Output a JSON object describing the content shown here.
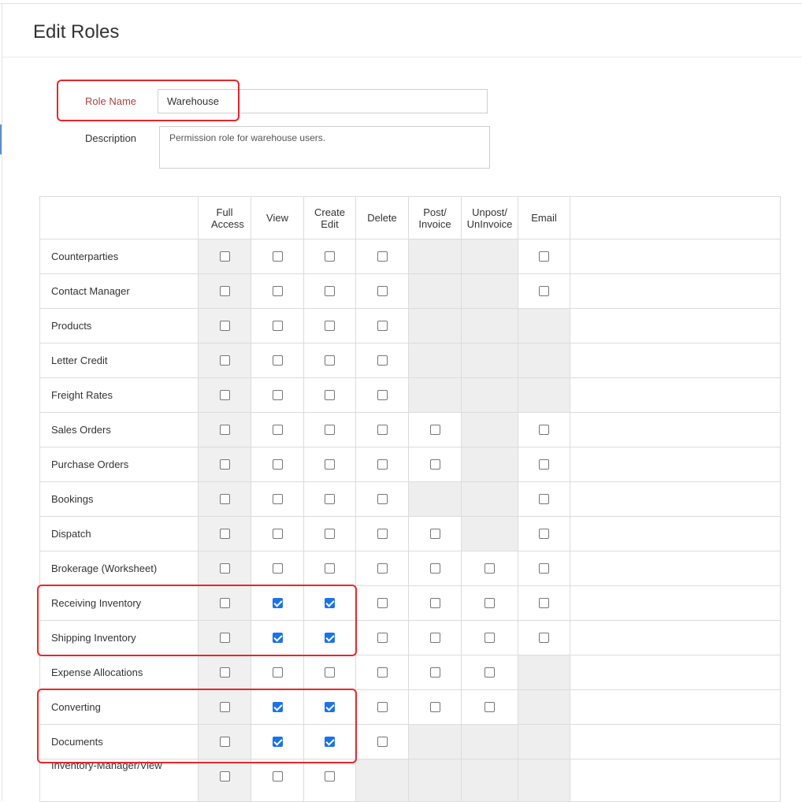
{
  "page": {
    "title": "Edit Roles"
  },
  "form": {
    "role_name_label": "Role Name",
    "role_name_value": "Warehouse",
    "description_label": "Description",
    "description_value": "Permission role for warehouse users."
  },
  "table": {
    "columns": [
      {
        "key": "full",
        "label": "Full Access"
      },
      {
        "key": "view",
        "label": "View"
      },
      {
        "key": "create",
        "label": "Create Edit"
      },
      {
        "key": "delete",
        "label": "Delete"
      },
      {
        "key": "post",
        "label": "Post/ Invoice"
      },
      {
        "key": "unpost",
        "label": "Unpost/ UnInvoice"
      },
      {
        "key": "email",
        "label": "Email"
      }
    ],
    "rows": [
      {
        "label": "Counterparties",
        "cells": {
          "full": false,
          "view": false,
          "create": false,
          "delete": false,
          "post": null,
          "unpost": null,
          "email": false
        }
      },
      {
        "label": "Contact Manager",
        "cells": {
          "full": false,
          "view": false,
          "create": false,
          "delete": false,
          "post": null,
          "unpost": null,
          "email": false
        }
      },
      {
        "label": "Products",
        "cells": {
          "full": false,
          "view": false,
          "create": false,
          "delete": false,
          "post": null,
          "unpost": null,
          "email": null
        }
      },
      {
        "label": "Letter Credit",
        "cells": {
          "full": false,
          "view": false,
          "create": false,
          "delete": false,
          "post": null,
          "unpost": null,
          "email": null
        }
      },
      {
        "label": "Freight Rates",
        "cells": {
          "full": false,
          "view": false,
          "create": false,
          "delete": false,
          "post": null,
          "unpost": null,
          "email": null
        }
      },
      {
        "label": "Sales Orders",
        "cells": {
          "full": false,
          "view": false,
          "create": false,
          "delete": false,
          "post": false,
          "unpost": null,
          "email": false
        }
      },
      {
        "label": "Purchase Orders",
        "cells": {
          "full": false,
          "view": false,
          "create": false,
          "delete": false,
          "post": false,
          "unpost": null,
          "email": false
        }
      },
      {
        "label": "Bookings",
        "cells": {
          "full": false,
          "view": false,
          "create": false,
          "delete": false,
          "post": null,
          "unpost": null,
          "email": false
        }
      },
      {
        "label": "Dispatch",
        "cells": {
          "full": false,
          "view": false,
          "create": false,
          "delete": false,
          "post": false,
          "unpost": null,
          "email": false
        }
      },
      {
        "label": "Brokerage (Worksheet)",
        "cells": {
          "full": false,
          "view": false,
          "create": false,
          "delete": false,
          "post": false,
          "unpost": false,
          "email": false
        }
      },
      {
        "label": "Receiving Inventory",
        "cells": {
          "full": false,
          "view": true,
          "create": true,
          "delete": false,
          "post": false,
          "unpost": false,
          "email": false
        }
      },
      {
        "label": "Shipping Inventory",
        "cells": {
          "full": false,
          "view": true,
          "create": true,
          "delete": false,
          "post": false,
          "unpost": false,
          "email": false
        }
      },
      {
        "label": "Expense Allocations",
        "cells": {
          "full": false,
          "view": false,
          "create": false,
          "delete": false,
          "post": false,
          "unpost": false,
          "email": null
        }
      },
      {
        "label": "Converting",
        "cells": {
          "full": false,
          "view": true,
          "create": true,
          "delete": false,
          "post": false,
          "unpost": false,
          "email": null
        }
      },
      {
        "label": "Documents",
        "cells": {
          "full": false,
          "view": true,
          "create": true,
          "delete": false,
          "post": null,
          "unpost": null,
          "email": null
        }
      },
      {
        "label": "Inventory-Manager/View",
        "cells": {
          "full": false,
          "view": false,
          "create": false,
          "delete": null,
          "post": null,
          "unpost": null,
          "email": null
        }
      }
    ]
  },
  "colors": {
    "highlight": "#e8262a",
    "checkbox_checked": "#1a73e8",
    "disabled_cell": "#eeeeee",
    "required_label": "#a94442"
  }
}
